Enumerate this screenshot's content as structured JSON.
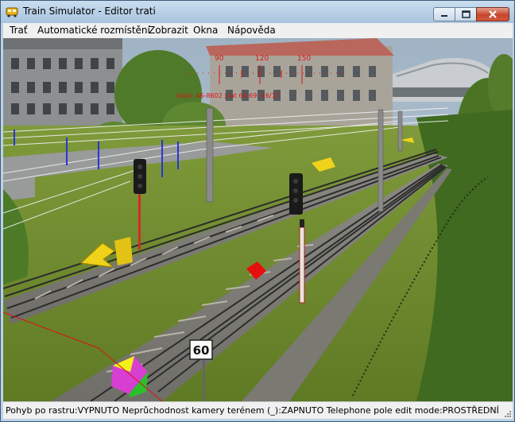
{
  "window": {
    "title": "Train Simulator - Editor trati",
    "controls": {
      "minimize": "minimize-icon",
      "maximize": "maximize-icon",
      "close": "close-icon"
    }
  },
  "menu": {
    "items": [
      {
        "label": "Trať"
      },
      {
        "label": "Automatické rozmístění"
      },
      {
        "label": "Zobrazit"
      },
      {
        "label": "Okna"
      },
      {
        "label": "Nápověda"
      }
    ]
  },
  "viewport": {
    "heading_marks": [
      "90",
      "120",
      "150"
    ],
    "coordinate_readout": "xlost: 46-8602 |  lat 64.69 -16/17",
    "speed_sign": "60"
  },
  "statusbar": {
    "text": "Pohyb po rastru:VYPNUTO Neprůchodnost kamery terénem (_):ZAPNUTO Telephone pole edit mode:PROSTŘEDNÍ"
  },
  "colors": {
    "titlebar": "#bcd2e6",
    "menubar": "#f0f0f0",
    "close_button": "#c6452b",
    "grass": "#6f8a2c",
    "overlay_red": "#e01010"
  }
}
